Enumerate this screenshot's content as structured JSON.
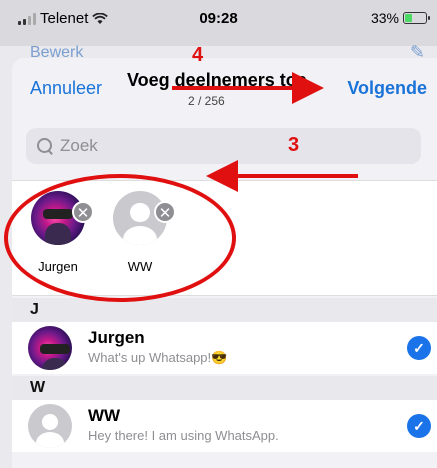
{
  "status_bar": {
    "carrier": "Telenet",
    "time": "09:28",
    "battery": "33%",
    "battery_level": 0.33,
    "icons": [
      "signal-icon",
      "wifi-icon",
      "battery-icon"
    ]
  },
  "behind": {
    "back_label": "Bewerk"
  },
  "nav": {
    "cancel_label": "Annuleer",
    "title": "Voeg deelnemers toe",
    "count": "2 / 256",
    "next_label": "Volgende"
  },
  "search": {
    "placeholder": "Zoek"
  },
  "selected": [
    {
      "name": "Jurgen",
      "avatar": "photo"
    },
    {
      "name": "WW",
      "avatar": "default"
    }
  ],
  "sections": [
    {
      "letter": "J",
      "contacts": [
        {
          "name": "Jurgen",
          "status": "What's up Whatsapp!😎",
          "checked": true
        }
      ]
    },
    {
      "letter": "W",
      "contacts": [
        {
          "name": "WW",
          "status": "Hey there! I am using WhatsApp.",
          "checked": true
        }
      ]
    }
  ],
  "annotations": {
    "label_3": "3",
    "label_4": "4",
    "color": "#e01010"
  },
  "colors": {
    "accent": "#1a73d9",
    "check": "#1a73e8",
    "annotation": "#e01010"
  }
}
